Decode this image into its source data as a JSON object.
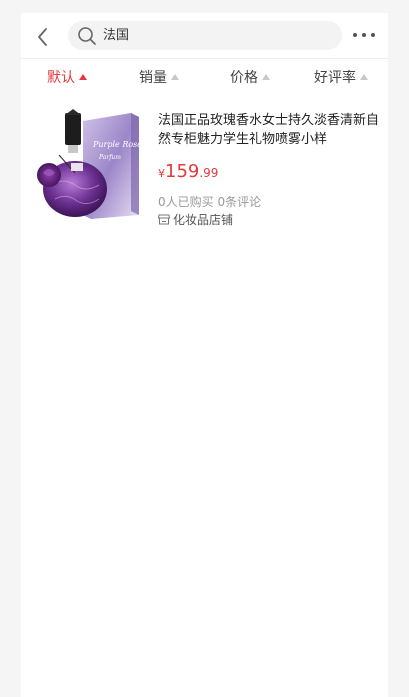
{
  "search": {
    "query": "法国"
  },
  "tabs": [
    {
      "label": "默认",
      "active": true
    },
    {
      "label": "销量",
      "active": false
    },
    {
      "label": "价格",
      "active": false
    },
    {
      "label": "好评率",
      "active": false
    }
  ],
  "product": {
    "title": "法国正品玫瑰香水女士持久淡香清新自然专柜魅力学生礼物喷雾小样",
    "currency": "¥",
    "price_int": "159",
    "price_dec": ".99",
    "sales": "0人已购买",
    "reviews": "0条评论",
    "shop": "化妆品店铺",
    "image_text_1": "Purple Rose",
    "image_text_2": "Parfum"
  },
  "icons": {
    "back": "chevron-left-icon",
    "search": "search-icon",
    "more": "more-dots-icon",
    "shop": "shop-icon"
  },
  "colors": {
    "accent": "#e4393c",
    "search_bg": "#f3f3f3",
    "bottle": "#5a2a7a"
  }
}
